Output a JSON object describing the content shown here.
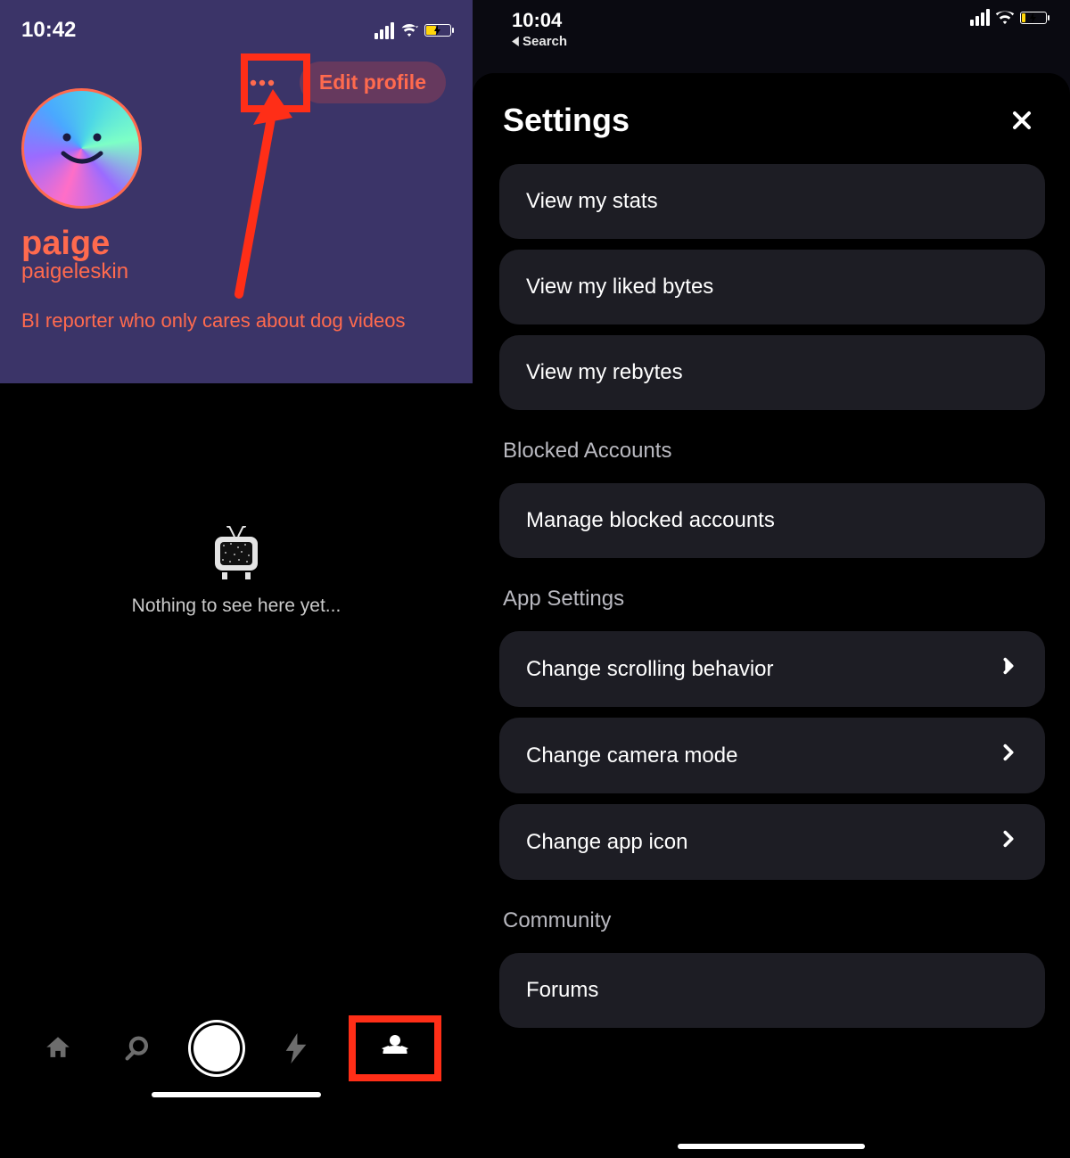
{
  "left": {
    "status": {
      "time": "10:42"
    },
    "actions": {
      "edit_profile": "Edit profile"
    },
    "profile": {
      "name": "paige",
      "handle": "paigeleskin",
      "bio": "BI reporter who only cares about dog videos"
    },
    "empty": {
      "text": "Nothing to see here yet..."
    }
  },
  "right": {
    "status": {
      "time": "10:04",
      "back": "Search"
    },
    "sheet": {
      "title": "Settings",
      "items": {
        "stats": "View my stats",
        "liked": "View my liked bytes",
        "rebytes": "View my rebytes"
      },
      "sections": {
        "blocked_label": "Blocked Accounts",
        "blocked_manage": "Manage blocked accounts",
        "app_label": "App Settings",
        "scroll": "Change scrolling behavior",
        "camera": "Change camera mode",
        "icon": "Change app icon",
        "community_label": "Community",
        "forums": "Forums"
      }
    }
  }
}
